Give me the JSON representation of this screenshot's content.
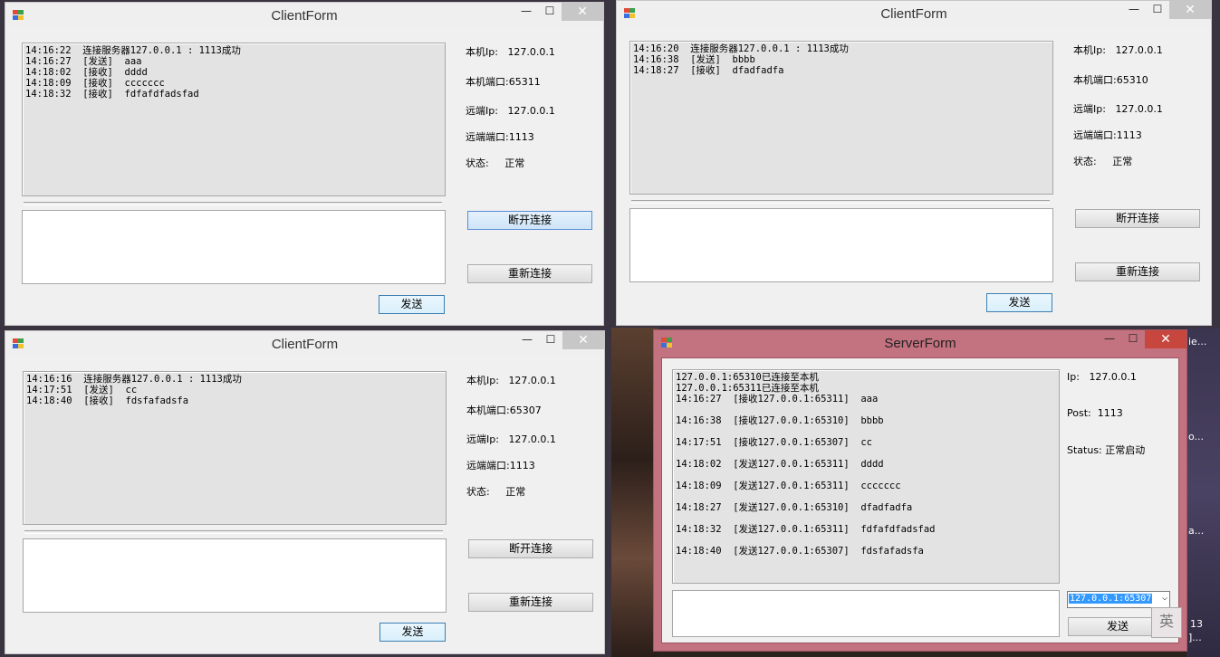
{
  "desktop": {
    "right_text": [
      "ie...",
      "o...",
      "a...",
      "13",
      "]..."
    ]
  },
  "client1": {
    "title": "ClientForm",
    "controls": {
      "minimize": "—",
      "maximize": "☐",
      "close": "✕"
    },
    "log": [
      [
        "14:16:22",
        "连接服务器127.0.0.1 : 1113成功"
      ],
      [
        "14:16:27",
        "[发送]  aaa"
      ],
      [
        "14:18:02",
        "[接收]  dddd"
      ],
      [
        "14:18:09",
        "[接收]  ccccccc"
      ],
      [
        "14:18:32",
        "[接收]  fdfafdfadsfad"
      ]
    ],
    "local_ip_label": "本机Ip:",
    "local_ip": "127.0.0.1",
    "local_port_label": "本机端口:",
    "local_port": "65311",
    "remote_ip_label": "远端Ip:",
    "remote_ip": "127.0.0.1",
    "remote_port_label": "远端端口:",
    "remote_port": "1113",
    "status_label": "状态:",
    "status": "正常",
    "disconnect": "断开连接",
    "reconnect": "重新连接",
    "send": "发送"
  },
  "client2": {
    "title": "ClientForm",
    "controls": {
      "minimize": "—",
      "maximize": "☐",
      "close": "✕"
    },
    "log": [
      [
        "14:16:20",
        "连接服务器127.0.0.1 : 1113成功"
      ],
      [
        "14:16:38",
        "[发送]  bbbb"
      ],
      [
        "14:18:27",
        "[接收]  dfadfadfa"
      ]
    ],
    "local_ip_label": "本机Ip:",
    "local_ip": "127.0.0.1",
    "local_port_label": "本机端口:",
    "local_port": "65310",
    "remote_ip_label": "远端Ip:",
    "remote_ip": "127.0.0.1",
    "remote_port_label": "远端端口:",
    "remote_port": "1113",
    "status_label": "状态:",
    "status": "正常",
    "disconnect": "断开连接",
    "reconnect": "重新连接",
    "send": "发送"
  },
  "client3": {
    "title": "ClientForm",
    "controls": {
      "minimize": "—",
      "maximize": "☐",
      "close": "✕"
    },
    "log": [
      [
        "14:16:16",
        "连接服务器127.0.0.1 : 1113成功"
      ],
      [
        "14:17:51",
        "[发送]  cc"
      ],
      [
        "14:18:40",
        "[接收]  fdsfafadsfa"
      ]
    ],
    "local_ip_label": "本机Ip:",
    "local_ip": "127.0.0.1",
    "local_port_label": "本机端口:",
    "local_port": "65307",
    "remote_ip_label": "远端Ip:",
    "remote_ip": "127.0.0.1",
    "remote_port_label": "远端端口:",
    "remote_port": "1113",
    "status_label": "状态:",
    "status": "正常",
    "disconnect": "断开连接",
    "reconnect": "重新连接",
    "send": "发送"
  },
  "server": {
    "title": "ServerForm",
    "controls": {
      "minimize": "—",
      "maximize": "☐",
      "close": "✕"
    },
    "log": [
      "127.0.0.1:65310已连接至本机",
      "127.0.0.1:65311已连接至本机",
      "14:16:27  [接收127.0.0.1:65311]  aaa",
      "14:16:38  [接收127.0.0.1:65310]  bbbb",
      "14:17:51  [接收127.0.0.1:65307]  cc",
      "14:18:02  [发送127.0.0.1:65311]  dddd",
      "14:18:09  [发送127.0.0.1:65311]  ccccccc",
      "14:18:27  [发送127.0.0.1:65310]  dfadfadfa",
      "14:18:32  [发送127.0.0.1:65311]  fdfafdfadsfad",
      "14:18:40  [发送127.0.0.1:65307]  fdsfafadsfa"
    ],
    "ip_label": "Ip:",
    "ip": "127.0.0.1",
    "port_label": "Post:",
    "port": "1113",
    "status_label": "Status:",
    "status": "正常启动",
    "client_select": "127.0.0.1:65307",
    "send": "发送"
  },
  "ime_indicator": "英",
  "colors": {
    "server_frame": "#c3727f",
    "close_active": "#c7473f",
    "selection": "#3399ff"
  }
}
